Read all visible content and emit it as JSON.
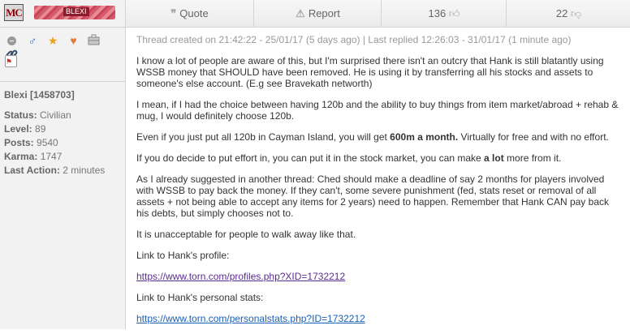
{
  "sidebar": {
    "faction_tag": "MC",
    "banner_text": "BLEXI",
    "user": "Blexi [1458703]",
    "stats": [
      {
        "label": "Status:",
        "value": "Civilian"
      },
      {
        "label": "Level:",
        "value": "89"
      },
      {
        "label": "Posts:",
        "value": "9540"
      },
      {
        "label": "Karma:",
        "value": "1747"
      },
      {
        "label": "Last Action:",
        "value": "2 minutes"
      }
    ]
  },
  "toolbar": {
    "quote_label": "Quote",
    "report_label": "Report",
    "likes": "136",
    "dislikes": "22"
  },
  "post": {
    "meta": "Thread created on 21:42:22 - 25/01/17 (5 days ago) | Last replied 12:26:03 - 31/01/17 (1 minute ago)",
    "p1": "I know a lot of people are aware of this, but I'm surprised there isn't an outcry that Hank is still blatantly using WSSB money that SHOULD have been removed. He is using it by transferring all his stocks and assets to someone's else account. (E.g see Bravekath networth)",
    "p2": "I mean, if I had the choice between having 120b and the ability to buy things from item market/abroad + rehab & mug, I would definitely choose 120b.",
    "p3_a": "Even if you just put all 120b in Cayman Island, you will get ",
    "p3_b": "600m a month.",
    "p3_c": " Virtually for free and with no effort.",
    "p4_a": "If you do decide to put effort in, you can put it in the stock market, you can make ",
    "p4_b": "a lot",
    "p4_c": " more from it.",
    "p5": "As I already suggested in another thread: Ched should make a deadline of say 2 months for players involved with WSSB to pay back the money. If they can't, some severe punishment (fed, stats reset or removal of all assets + not being able to accept any items for 2 years) need to happen. Remember that Hank CAN pay back his debts, but simply chooses not to.",
    "p6": "It is unacceptable for people to walk away like that.",
    "p7": "Link to Hank's profile:",
    "link1": "https://www.torn.com/profiles.php?XID=1732212",
    "p8": "Link to Hank's personal stats:",
    "link2": "https://www.torn.com/personalstats.php?ID=1732212"
  }
}
